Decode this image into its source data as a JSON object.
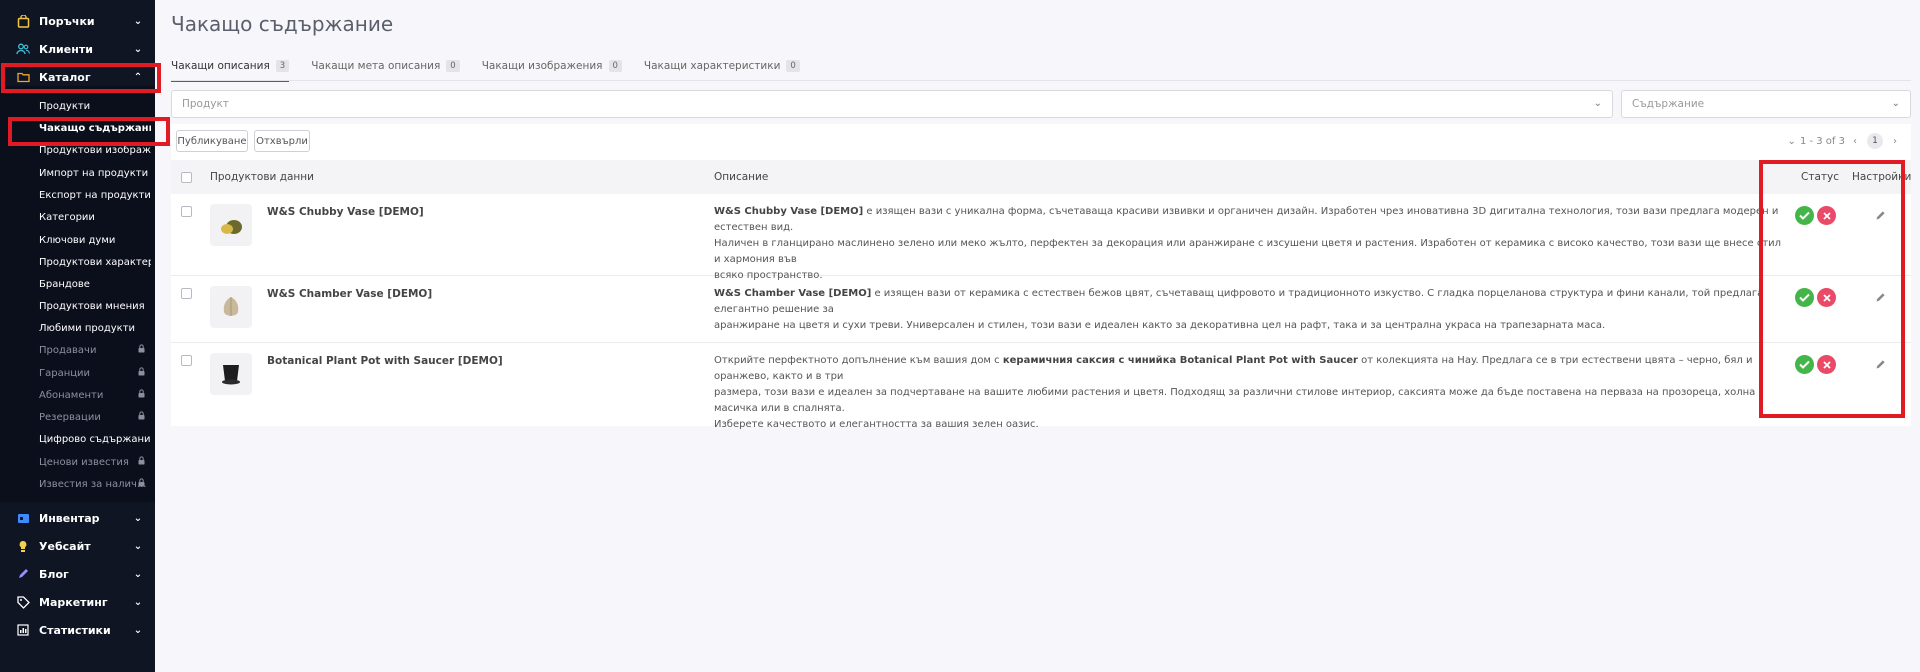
{
  "sidebar": {
    "top_items": [
      {
        "label": "Поръчки",
        "icon": "bag-icon"
      },
      {
        "label": "Клиенти",
        "icon": "users-icon"
      },
      {
        "label": "Каталог",
        "icon": "folder-icon"
      }
    ],
    "catalog_sub_items": [
      {
        "label": "Продукти",
        "locked": false
      },
      {
        "label": "Чакащо съдържание",
        "locked": false
      },
      {
        "label": "Продуктови изображ...",
        "locked": false
      },
      {
        "label": "Импорт на продукти",
        "locked": false
      },
      {
        "label": "Експорт на продукти",
        "locked": false
      },
      {
        "label": "Категории",
        "locked": false
      },
      {
        "label": "Ключови думи",
        "locked": false
      },
      {
        "label": "Продуктови характер...",
        "locked": false
      },
      {
        "label": "Брандове",
        "locked": false
      },
      {
        "label": "Продуктови мнения",
        "locked": false
      },
      {
        "label": "Любими продукти",
        "locked": false
      },
      {
        "label": "Продавачи",
        "locked": true
      },
      {
        "label": "Гаранции",
        "locked": true
      },
      {
        "label": "Абонаменти",
        "locked": true
      },
      {
        "label": "Резервации",
        "locked": true
      },
      {
        "label": "Цифрово съдържание",
        "locked": false
      },
      {
        "label": "Ценови известия",
        "locked": true
      },
      {
        "label": "Известия за налич...",
        "locked": true
      }
    ],
    "bottom_items": [
      {
        "label": "Инвентар",
        "icon": "inventory-icon"
      },
      {
        "label": "Уебсайт",
        "icon": "website-icon"
      },
      {
        "label": "Блог",
        "icon": "pen-icon"
      },
      {
        "label": "Маркетинг",
        "icon": "tag-icon"
      },
      {
        "label": "Статистики",
        "icon": "stats-icon"
      }
    ]
  },
  "page": {
    "title": "Чакащо съдържание",
    "tabs": [
      {
        "label": "Чакащи описания",
        "count": "3"
      },
      {
        "label": "Чакащи мета описания",
        "count": "0"
      },
      {
        "label": "Чакащи изображения",
        "count": "0"
      },
      {
        "label": "Чакащи характеристики",
        "count": "0"
      }
    ],
    "filters": {
      "product_placeholder": "Продукт",
      "content_placeholder": "Съдържание"
    },
    "toolbar": {
      "publish_label": "Публикуване",
      "reject_label": "Отхвърли",
      "range_text": "1 - 3 of 3",
      "current_page": "1"
    },
    "table": {
      "headers": {
        "product": "Продуктови данни",
        "description": "Описание",
        "status": "Статус",
        "settings": "Настройки"
      },
      "rows": [
        {
          "name": "W&S Chubby Vase [DEMO]",
          "desc_bold": "W&S Chubby Vase [DEMO]",
          "desc_line1": " е изящен вази с уникална форма, съчетаваща красиви извивки и органичен дизайн. Изработен чрез иновативна 3D дигитална технология, този вази предлага модерен и естествен вид.",
          "desc_line2": "Наличен в гланцирано маслинено зелено или меко жълто, перфектен за декорация или аранжиране с изсушени цветя и растения. Изработен от керамика с високо качество, този вази ще внесе стил и хармония във",
          "desc_line3": "всяко пространство."
        },
        {
          "name": "W&S Chamber Vase [DEMO]",
          "desc_bold": "W&S Chamber Vase [DEMO]",
          "desc_line1": " е изящен вази от керамика с естествен бежов цвят, съчетаващ цифровото и традиционното изкуство. С гладка порцеланова структура и фини канали, той предлага елегантно решение за",
          "desc_line2": "аранжиране на цветя и сухи треви. Универсален и стилен, този вази е идеален както за декоративна цел на рафт, така и за централна украса на трапезарната маса."
        },
        {
          "name": "Botanical Plant Pot with Saucer [DEMO]",
          "desc_pre": "Открийте перфектното допълнение към вашия дом с ",
          "desc_bold": "керамичния саксия с чинийка Botanical Plant Pot with Saucer",
          "desc_line1": " от колекцията на Hay. Предлага се в три естествени цвята – черно, бял и оранжево, както и в три",
          "desc_line2": "размера, този вази е идеален за подчертаване на вашите любими растения и цветя. Подходящ за различни стилове интериор, саксията може да бъде поставена на перваза на прозореца, холна масичка или в спалнята.",
          "desc_line3": "Изберете качеството и елегантността за вашия зелен оазис."
        }
      ]
    }
  },
  "colors": {
    "sidebar_bg": "#101524",
    "highlight": "#e01b24",
    "approve": "#44b549",
    "reject": "#e94a68",
    "tab_accent": "#6c3de0"
  }
}
